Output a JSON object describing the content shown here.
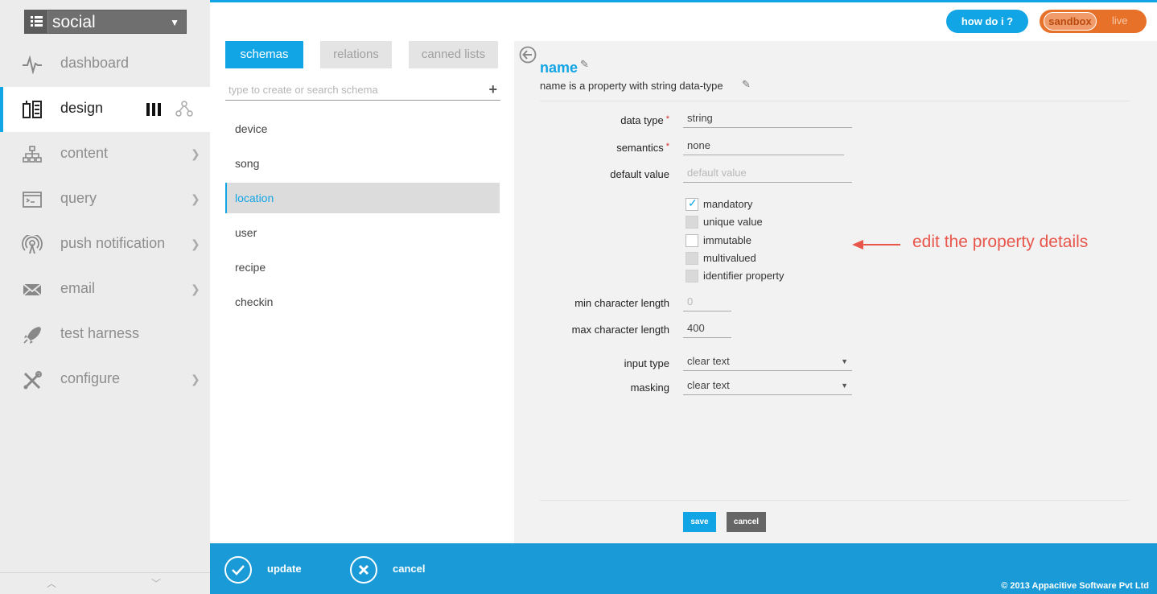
{
  "app": {
    "name": "social"
  },
  "nav": {
    "items": [
      {
        "label": "dashboard",
        "icon": "pulse-icon",
        "has_chevron": false
      },
      {
        "label": "design",
        "icon": "design-icon",
        "active": true
      },
      {
        "label": "content",
        "icon": "sitemap-icon",
        "has_chevron": true
      },
      {
        "label": "query",
        "icon": "terminal-icon",
        "has_chevron": true
      },
      {
        "label": "push notification",
        "icon": "broadcast-icon",
        "has_chevron": true
      },
      {
        "label": "email",
        "icon": "envelope-icon",
        "has_chevron": true
      },
      {
        "label": "test harness",
        "icon": "rocket-icon",
        "has_chevron": false
      },
      {
        "label": "configure",
        "icon": "tools-icon",
        "has_chevron": true
      }
    ]
  },
  "tabs": {
    "schemas": "schemas",
    "relations": "relations",
    "canned": "canned lists"
  },
  "search": {
    "placeholder": "type to create or search schema"
  },
  "schemas": [
    "device",
    "song",
    "location",
    "user",
    "recipe",
    "checkin"
  ],
  "selected_schema": "location",
  "property": {
    "name": "name",
    "description": "name is a property with string data-type"
  },
  "form": {
    "data_type_label": "data type",
    "data_type_value": "string",
    "semantics_label": "semantics",
    "semantics_value": "none",
    "default_label": "default value",
    "default_placeholder": "default value",
    "checkboxes": [
      {
        "label": "mandatory",
        "checked": true,
        "disabled": false
      },
      {
        "label": "unique value",
        "checked": false,
        "disabled": true
      },
      {
        "label": "immutable",
        "checked": false,
        "disabled": false
      },
      {
        "label": "multivalued",
        "checked": false,
        "disabled": true
      },
      {
        "label": "identifier property",
        "checked": false,
        "disabled": true
      }
    ],
    "min_label": "min character length",
    "min_placeholder": "0",
    "max_label": "max character length",
    "max_value": "400",
    "input_type_label": "input type",
    "input_type_value": "clear text",
    "masking_label": "masking",
    "masking_value": "clear text",
    "save": "save",
    "cancel": "cancel"
  },
  "annotation": "edit the property details",
  "header": {
    "howdoi": "how do i ?",
    "sandbox": "sandbox",
    "live": "live"
  },
  "bottom": {
    "update": "update",
    "cancel": "cancel",
    "copyright": "© 2013 Appacitive Software Pvt Ltd"
  },
  "colors": {
    "accent": "#12a5e5",
    "bottombar": "#1a9bd7",
    "env": "#e8712a",
    "annotation": "#e8564b"
  }
}
